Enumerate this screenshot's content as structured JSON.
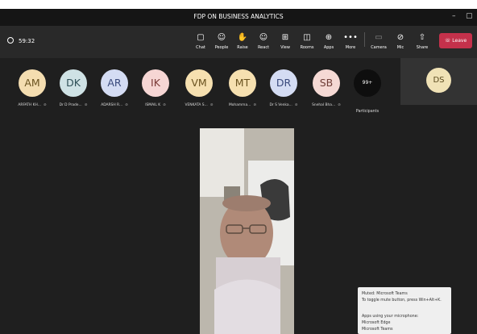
{
  "window": {
    "title": "FDP ON BUSINESS ANALYTICS",
    "minimize": "–",
    "maximize": "▢"
  },
  "toolbar": {
    "timer": "59:32",
    "buttons": [
      {
        "label": "Chat",
        "icon": "chat-icon"
      },
      {
        "label": "People",
        "icon": "people-icon"
      },
      {
        "label": "Raise",
        "icon": "hand-icon"
      },
      {
        "label": "React",
        "icon": "smile-icon"
      },
      {
        "label": "View",
        "icon": "grid-icon"
      },
      {
        "label": "Rooms",
        "icon": "rooms-icon"
      },
      {
        "label": "Apps",
        "icon": "apps-icon"
      },
      {
        "label": "More",
        "icon": "more-icon"
      },
      {
        "label": "Camera",
        "icon": "camera-off-icon"
      },
      {
        "label": "Mic",
        "icon": "mic-off-icon"
      },
      {
        "label": "Share",
        "icon": "share-icon"
      }
    ],
    "leave": "Leave"
  },
  "participants": [
    {
      "initials": "AM",
      "name": "ARFATH KH...",
      "bg": "#f4ddb0",
      "fg": "#6a5320"
    },
    {
      "initials": "DK",
      "name": "Dr D Prade...",
      "bg": "#cfe2e5",
      "fg": "#2e4f57"
    },
    {
      "initials": "AR",
      "name": "ADARSH R...",
      "bg": "#d4dcf3",
      "fg": "#3a4a7c"
    },
    {
      "initials": "IK",
      "name": "ISMAIL K",
      "bg": "#f6d6d4",
      "fg": "#7a3a36"
    },
    {
      "initials": "VM",
      "name": "VENKATA S...",
      "bg": "#f6e0b0",
      "fg": "#6a5320"
    },
    {
      "initials": "MT",
      "name": "Mohamma...",
      "bg": "#f6e0b0",
      "fg": "#6a5320"
    },
    {
      "initials": "DR",
      "name": "Dr S Venka...",
      "bg": "#d4dcf3",
      "fg": "#3a4a7c"
    },
    {
      "initials": "SB",
      "name": "Snehal Bha...",
      "bg": "#f5d9d4",
      "fg": "#6e3d36"
    }
  ],
  "more_participants": {
    "count": "99+",
    "label": "Participants"
  },
  "self_view": {
    "initials": "DS"
  },
  "tooltip": {
    "lines": [
      "Muted: Microsoft Teams",
      "To toggle mute button, press Win+Alt+K.",
      "",
      "Apps using your microphone:",
      "Microsoft Edge",
      "Microsoft Teams"
    ]
  }
}
